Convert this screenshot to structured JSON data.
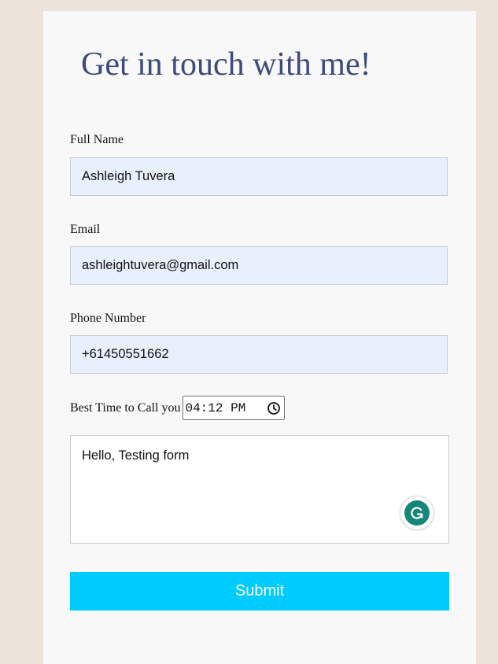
{
  "form": {
    "title": "Get in touch with me!",
    "full_name": {
      "label": "Full Name",
      "value": "Ashleigh Tuvera"
    },
    "email": {
      "label": "Email",
      "value": "ashleightuvera@gmail.com"
    },
    "phone": {
      "label": "Phone Number",
      "value": "+61450551662"
    },
    "best_time": {
      "label": "Best Time to Call you",
      "value": "04:12 PM"
    },
    "message": {
      "value": "Hello, Testing form"
    },
    "submit_label": "Submit"
  },
  "colors": {
    "page_background": "#ece3da",
    "card_background": "#f8f8f8",
    "title": "#3d4a7a",
    "autofill_field": "#e8f0fe",
    "submit_button": "#00cbff",
    "grammarly": "#15867a"
  },
  "icons": {
    "time_picker": "clock-icon",
    "extension": "grammarly-icon"
  }
}
